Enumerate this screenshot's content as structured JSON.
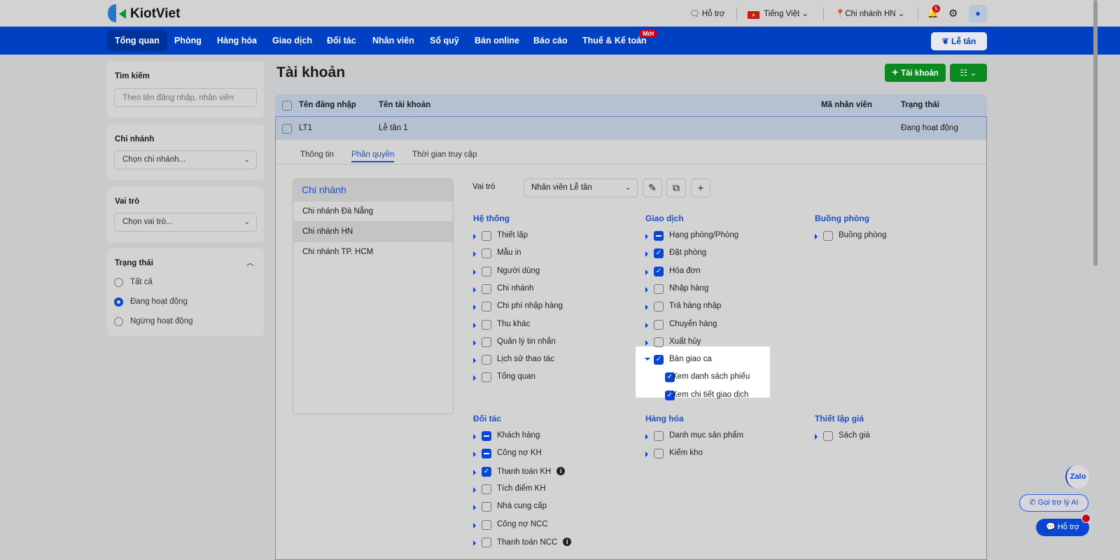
{
  "header": {
    "brand": "KiotViet",
    "support": "Hỗ trợ",
    "language": "Tiếng Việt",
    "branch": "Chi nhánh HN",
    "notifications": "5"
  },
  "nav": {
    "items": [
      "Tổng quan",
      "Phòng",
      "Hàng hóa",
      "Giao dịch",
      "Đối tác",
      "Nhân viên",
      "Sổ quỹ",
      "Bán online",
      "Báo cáo",
      "Thuế & Kế toán"
    ],
    "new_badge": "Mới",
    "reception": "Lễ tân"
  },
  "sidebar": {
    "search_label": "Tìm kiếm",
    "search_placeholder": "Theo tên đăng nhập, nhân viên",
    "branch_label": "Chi nhánh",
    "branch_value": "Chọn chi nhánh...",
    "role_label": "Vai trò",
    "role_value": "Chọn vai trò...",
    "status_label": "Trạng thái",
    "status_options": [
      "Tất cả",
      "Đang hoạt động",
      "Ngừng hoạt động"
    ],
    "status_selected": 1
  },
  "page": {
    "title": "Tài khoản",
    "add_button": "Tài khoản"
  },
  "table": {
    "headers": [
      "Tên đăng nhập",
      "Tên tài khoản",
      "Mã nhân viên",
      "Trạng thái"
    ],
    "row": {
      "username": "LT1",
      "name": "Lễ tân 1",
      "code": "",
      "status": "Đang hoạt động"
    }
  },
  "detail": {
    "tabs": [
      "Thông tin",
      "Phân quyền",
      "Thời gian truy cập"
    ],
    "active_tab": 1,
    "branch_header": "Chi nhánh",
    "branches": [
      "Chi nhánh Đà Nẵng",
      "Chi nhánh HN",
      "Chi nhánh TP. HCM"
    ],
    "role_label": "Vai trò",
    "role_value": "Nhân viên Lễ tân",
    "sections": [
      {
        "title": "Hệ thống",
        "items": [
          {
            "label": "Thiết lập",
            "state": "off"
          },
          {
            "label": "Mẫu in",
            "state": "off"
          },
          {
            "label": "Người dùng",
            "state": "off"
          },
          {
            "label": "Chi nhánh",
            "state": "off"
          },
          {
            "label": "Chi phí nhập hàng",
            "state": "off"
          },
          {
            "label": "Thu khác",
            "state": "off"
          },
          {
            "label": "Quản lý tin nhắn",
            "state": "off"
          },
          {
            "label": "Lịch sử thao tác",
            "state": "off"
          },
          {
            "label": "Tổng quan",
            "state": "off"
          }
        ]
      },
      {
        "title": "Giao dịch",
        "items": [
          {
            "label": "Hạng phòng/Phòng",
            "state": "mid"
          },
          {
            "label": "Đặt phòng",
            "state": "on"
          },
          {
            "label": "Hóa đơn",
            "state": "on"
          },
          {
            "label": "Nhập hàng",
            "state": "off"
          },
          {
            "label": "Trả hàng nhập",
            "state": "off"
          },
          {
            "label": "Chuyển hàng",
            "state": "off"
          },
          {
            "label": "Xuất hủy",
            "state": "off"
          },
          {
            "label": "Bàn giao ca",
            "state": "on",
            "expanded": true,
            "children": [
              {
                "label": "Xem danh sách phiếu",
                "state": "on"
              },
              {
                "label": "Xem chi tiết giao dịch",
                "state": "on"
              }
            ]
          }
        ]
      },
      {
        "title": "Buồng phòng",
        "items": [
          {
            "label": "Buồng phòng",
            "state": "off"
          }
        ]
      },
      {
        "title": "Đối tác",
        "items": [
          {
            "label": "Khách hàng",
            "state": "mid"
          },
          {
            "label": "Công nợ KH",
            "state": "mid"
          },
          {
            "label": "Thanh toán KH",
            "state": "on",
            "info": true
          },
          {
            "label": "Tích điểm KH",
            "state": "off"
          },
          {
            "label": "Nhà cung cấp",
            "state": "off"
          },
          {
            "label": "Công nợ NCC",
            "state": "off"
          },
          {
            "label": "Thanh toán NCC",
            "state": "off",
            "info": true
          }
        ]
      },
      {
        "title": "Hàng hóa",
        "items": [
          {
            "label": "Danh mục sản phẩm",
            "state": "off"
          },
          {
            "label": "Kiểm kho",
            "state": "off"
          }
        ]
      },
      {
        "title": "Thiết lập giá",
        "items": [
          {
            "label": "Sách giá",
            "state": "off"
          }
        ]
      }
    ]
  },
  "floating": {
    "zalo": "Zalo",
    "ai_call": "Gọi trợ lý AI",
    "support": "Hỗ trợ"
  }
}
